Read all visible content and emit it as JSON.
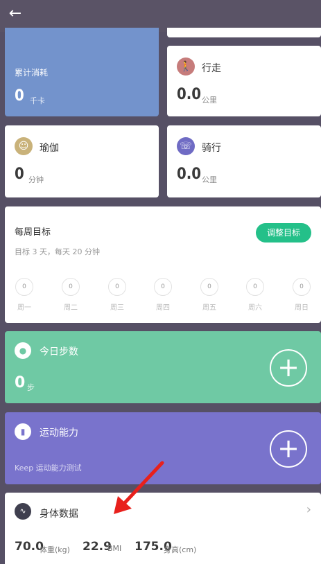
{
  "header": {
    "back_icon": "back-arrow-icon"
  },
  "calorie": {
    "title": "累计消耗",
    "value": "0",
    "unit": "千卡"
  },
  "walk": {
    "title": "行走",
    "value": "0.0",
    "unit": "公里",
    "icon": "walk-icon",
    "color": "#c67c7b"
  },
  "yoga": {
    "title": "瑜伽",
    "value": "0",
    "unit": "分钟",
    "icon": "yoga-icon",
    "color": "#c9b27a"
  },
  "cycling": {
    "title": "骑行",
    "value": "0.0",
    "unit": "公里",
    "icon": "bicycle-icon",
    "color": "#6f6bc4"
  },
  "weekly_goal": {
    "title": "每周目标",
    "subtitle": "目标 3 天，每天 20 分钟",
    "adjust_button": "调整目标",
    "days": [
      {
        "label": "周一",
        "value": "0"
      },
      {
        "label": "周二",
        "value": "0"
      },
      {
        "label": "周三",
        "value": "0"
      },
      {
        "label": "周四",
        "value": "0"
      },
      {
        "label": "周五",
        "value": "0"
      },
      {
        "label": "周六",
        "value": "0"
      },
      {
        "label": "周日",
        "value": "0"
      }
    ]
  },
  "steps": {
    "title": "今日步数",
    "value": "0",
    "unit": "步",
    "icon": "footprint-icon"
  },
  "ability": {
    "title": "运动能力",
    "subtitle": "Keep 运动能力测试",
    "icon": "bar-chart-icon"
  },
  "body_data": {
    "title": "身体数据",
    "weight_value": "70.0",
    "weight_unit": "体重(kg)",
    "bmi_value": "22.9",
    "bmi_unit": "BMI",
    "height_value": "175.0",
    "height_unit": "身高(cm)"
  },
  "colors": {
    "green": "#24c089",
    "teal": "#6fc9a4",
    "purple": "#7973cc",
    "blue": "#7393cc",
    "annotation_arrow": "#e8201c"
  }
}
